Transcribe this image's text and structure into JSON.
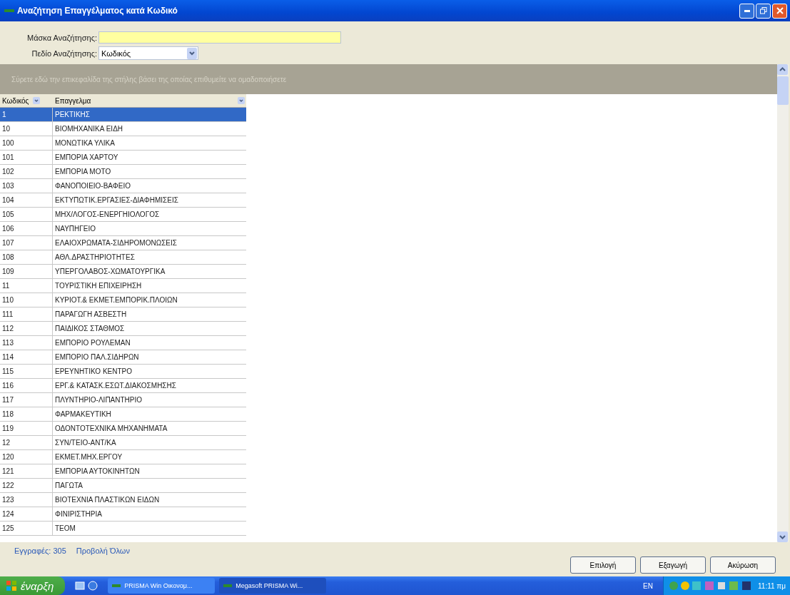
{
  "window": {
    "title": "Αναζήτηση Επαγγέλματος κατά Κωδικό"
  },
  "form": {
    "mask_label": "Μάσκα Αναζήτησης:",
    "field_label": "Πεδίο Αναζήτησης:",
    "field_value": "Κωδικός"
  },
  "group_panel": {
    "hint": "Σύρετε εδώ την επικεφαλίδα της στήλης βάσει της οποίας επιθυμείτε να ομαδοποιήσετε"
  },
  "table": {
    "columns": [
      "Κωδικός",
      "Επαγγελμα"
    ],
    "rows": [
      {
        "code": "1",
        "name": "ΡΕΚΤΙΚΗΣ",
        "selected": true
      },
      {
        "code": "10",
        "name": "ΒΙΟΜΗΧΑΝΙΚΑ ΕΙΔΗ",
        "selected": false
      },
      {
        "code": "100",
        "name": "ΜΟΝΩΤΙΚΑ ΥΛΙΚΑ",
        "selected": false
      },
      {
        "code": "101",
        "name": "ΕΜΠΟΡΙΑ ΧΑΡΤΟΥ",
        "selected": false
      },
      {
        "code": "102",
        "name": "ΕΜΠΟΡΙΑ ΜΟΤΟ",
        "selected": false
      },
      {
        "code": "103",
        "name": "ΦΑΝΟΠΟΙΕΙΟ-ΒΑΦΕΙΟ",
        "selected": false
      },
      {
        "code": "104",
        "name": "ΕΚΤΥΠΩΤΙΚ.ΕΡΓΑΣΙΕΣ-ΔΙΑΦΗΜΙΣΕΙΣ",
        "selected": false
      },
      {
        "code": "105",
        "name": "ΜΗΧ/ΛΟΓΟΣ-ΕΝΕΡΓΗΙΟΛΟΓΟΣ",
        "selected": false
      },
      {
        "code": "106",
        "name": "ΝΑΥΠΗΓΕΙΟ",
        "selected": false
      },
      {
        "code": "107",
        "name": "ΕΛΑΙΟΧΡΩΜΑΤΑ-ΣΙΔΗΡΟΜΟΝΩΣΕΙΣ",
        "selected": false
      },
      {
        "code": "108",
        "name": "ΑΘΛ.ΔΡΑΣΤΗΡΙΟΤΗΤΕΣ",
        "selected": false
      },
      {
        "code": "109",
        "name": "ΥΠΕΡΓΟΛΑΒΟΣ-ΧΩΜΑΤΟΥΡΓΙΚΑ",
        "selected": false
      },
      {
        "code": "11",
        "name": "ΤΟΥΡΙΣΤΙΚΗ ΕΠΙΧΕΙΡΗΣΗ",
        "selected": false
      },
      {
        "code": "110",
        "name": "ΚΥΡΙΟΤ.& ΕΚΜΕΤ.ΕΜΠΟΡΙΚ.ΠΛΟΙΩΝ",
        "selected": false
      },
      {
        "code": "111",
        "name": "ΠΑΡΑΓΩΓΗ ΑΣΒΕΣΤΗ",
        "selected": false
      },
      {
        "code": "112",
        "name": "ΠΑΙΔΙΚΟΣ ΣΤΑΘΜΟΣ",
        "selected": false
      },
      {
        "code": "113",
        "name": "ΕΜΠΟΡΙΟ ΡΟΥΛΕΜΑΝ",
        "selected": false
      },
      {
        "code": "114",
        "name": "ΕΜΠΟΡΙΟ ΠΑΛ.ΣΙΔΗΡΩΝ",
        "selected": false
      },
      {
        "code": "115",
        "name": "ΕΡΕΥΝΗΤΙΚΟ ΚΕΝΤΡΟ",
        "selected": false
      },
      {
        "code": "116",
        "name": "ΕΡΓ.& ΚΑΤΑΣΚ.ΕΣΩΤ.ΔΙΑΚΟΣΜΗΣΗΣ",
        "selected": false
      },
      {
        "code": "117",
        "name": "ΠΛΥΝΤΗΡΙΟ-ΛΙΠΑΝΤΗΡΙΟ",
        "selected": false
      },
      {
        "code": "118",
        "name": "ΦΑΡΜΑΚΕΥΤΙΚΗ",
        "selected": false
      },
      {
        "code": "119",
        "name": "ΟΔΟΝΤΟΤΕΧΝΙΚΑ ΜΗΧΑΝΗΜΑΤΑ",
        "selected": false
      },
      {
        "code": "12",
        "name": "ΣΥΝ/ΤΕΙΟ-ΑΝΤ/ΚΑ",
        "selected": false
      },
      {
        "code": "120",
        "name": "ΕΚΜΕΤ.ΜΗΧ.ΕΡΓΟΥ",
        "selected": false
      },
      {
        "code": "121",
        "name": "ΕΜΠΟΡΙΑ ΑΥΤΟΚΙΝΗΤΩΝ",
        "selected": false
      },
      {
        "code": "122",
        "name": "ΠΑΓΩΤΑ",
        "selected": false
      },
      {
        "code": "123",
        "name": "ΒΙΟΤΕΧΝΙΑ ΠΛΑΣΤΙΚΩΝ ΕΙΔΩΝ",
        "selected": false
      },
      {
        "code": "124",
        "name": "ΦΙΝΙΡΙΣΤΗΡΙΑ",
        "selected": false
      },
      {
        "code": "125",
        "name": "ΤΕΟΜ",
        "selected": false
      }
    ]
  },
  "footer": {
    "records": "Εγγραφές: 305",
    "show_all": "Προβολή Όλων"
  },
  "buttons": [
    "Επιλογή",
    "Εξαγωγή",
    "Ακύρωση"
  ],
  "taskbar": {
    "start": "έναρξη",
    "tasks": [
      {
        "label": "PRISMA Win Οικονομ...",
        "selected": false
      },
      {
        "label": "Megasoft PRISMA Wi...",
        "selected": true
      }
    ],
    "language": "EN",
    "clock": "11:11 πμ"
  }
}
